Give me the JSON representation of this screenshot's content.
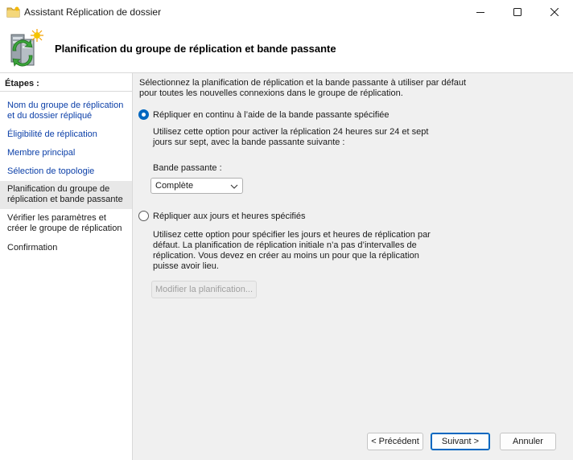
{
  "window": {
    "title": "Assistant Réplication de dossier",
    "controls": {
      "minimize": "minimize-icon",
      "maximize": "maximize-icon",
      "close": "close-icon"
    }
  },
  "header": {
    "title": "Planification du groupe de réplication et bande passante",
    "icon": "replication-server-icon"
  },
  "sidebar": {
    "title": "Étapes :",
    "steps": [
      {
        "label": "Nom du groupe de réplication et du dossier répliqué",
        "state": "link"
      },
      {
        "label": "Éligibilité de réplication",
        "state": "link"
      },
      {
        "label": "Membre principal",
        "state": "link"
      },
      {
        "label": "Sélection de topologie",
        "state": "link"
      },
      {
        "label": "Planification du groupe de réplication et bande passante",
        "state": "current"
      },
      {
        "label": "Vérifier les paramètres et créer le groupe de réplication",
        "state": "upcoming"
      },
      {
        "label": "Confirmation",
        "state": "upcoming"
      }
    ]
  },
  "main": {
    "description": "Sélectionnez la planification de réplication et la bande passante à utiliser par défaut pour toutes les nouvelles connexions dans le groupe de réplication.",
    "option_continuous": {
      "label": "Répliquer en continu à l’aide de la bande passante spécifiée",
      "selected": true,
      "help": "Utilisez cette option pour activer la réplication 24 heures sur 24 et sept jours sur sept, avec la bande passante suivante :"
    },
    "bandwidth": {
      "label": "Bande passante :",
      "value": "Complète"
    },
    "option_schedule": {
      "label": "Répliquer aux jours et heures spécifiés",
      "selected": false,
      "help": "Utilisez cette option pour spécifier les jours et heures de réplication par défaut. La planification de réplication initiale n’a pas d’intervalles de réplication. Vous devez en créer au moins un pour que la réplication puisse avoir lieu."
    },
    "modify_schedule_button": "Modifier la planification..."
  },
  "footer": {
    "previous": "< Précédent",
    "next": "Suivant >",
    "cancel": "Annuler"
  },
  "colors": {
    "accent": "#0067c0",
    "link": "#0b3fa8",
    "panel": "#f0f0f0",
    "current_step": "#e8e8e8"
  }
}
